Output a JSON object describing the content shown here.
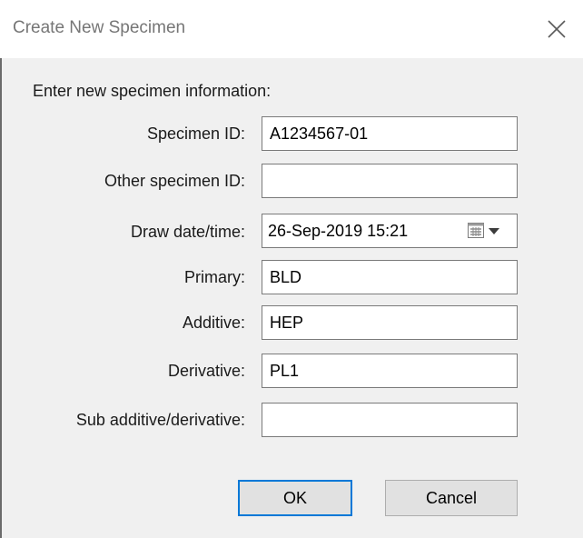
{
  "window": {
    "title": "Create New Specimen",
    "close_icon": "close-icon"
  },
  "form": {
    "intro": "Enter new specimen information:",
    "fields": {
      "specimen_id": {
        "label": "Specimen ID:",
        "value": "A1234567-01"
      },
      "other_specimen_id": {
        "label": "Other specimen ID:",
        "value": ""
      },
      "draw_datetime": {
        "label": "Draw date/time:",
        "value": "26-Sep-2019 15:21",
        "icon": "calendar-icon"
      },
      "primary": {
        "label": "Primary:",
        "value": "BLD"
      },
      "additive": {
        "label": "Additive:",
        "value": "HEP"
      },
      "derivative": {
        "label": "Derivative:",
        "value": "PL1"
      },
      "sub_additive_derivative": {
        "label": "Sub additive/derivative:",
        "value": ""
      }
    }
  },
  "buttons": {
    "ok": "OK",
    "cancel": "Cancel"
  },
  "colors": {
    "title_bar": "#ffffff",
    "dialog_background": "#f0f0f0",
    "default_button_border": "#0078d7",
    "field_border": "#7a7a7a"
  }
}
